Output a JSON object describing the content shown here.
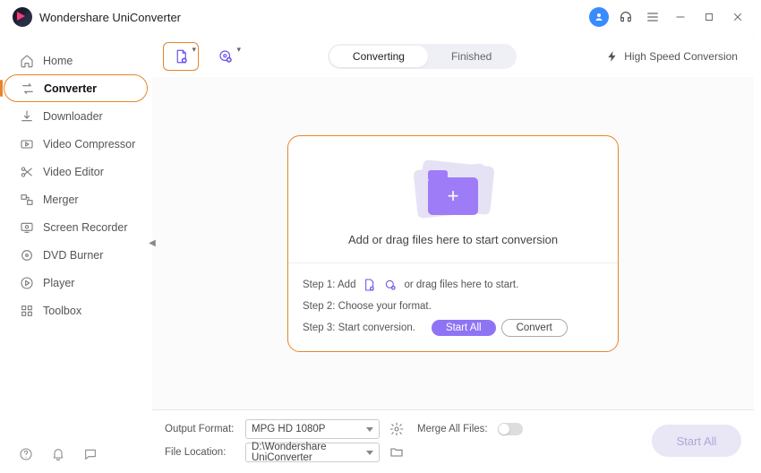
{
  "app": {
    "title": "Wondershare UniConverter"
  },
  "sidebar": {
    "items": [
      {
        "label": "Home"
      },
      {
        "label": "Converter"
      },
      {
        "label": "Downloader"
      },
      {
        "label": "Video Compressor"
      },
      {
        "label": "Video Editor"
      },
      {
        "label": "Merger"
      },
      {
        "label": "Screen Recorder"
      },
      {
        "label": "DVD Burner"
      },
      {
        "label": "Player"
      },
      {
        "label": "Toolbox"
      }
    ]
  },
  "toolbar": {
    "tabs": {
      "converting": "Converting",
      "finished": "Finished"
    },
    "high_speed": "High Speed Conversion"
  },
  "dropzone": {
    "headline": "Add or drag files here to start conversion",
    "step1_prefix": "Step 1: Add",
    "step1_suffix": "or drag files here to start.",
    "step2": "Step 2: Choose your format.",
    "step3": "Step 3: Start conversion.",
    "start_all": "Start All",
    "convert": "Convert"
  },
  "bottom": {
    "output_format_label": "Output Format:",
    "output_format_value": "MPG HD 1080P",
    "merge_label": "Merge All Files:",
    "file_location_label": "File Location:",
    "file_location_value": "D:\\Wondershare UniConverter",
    "start_all": "Start All"
  }
}
